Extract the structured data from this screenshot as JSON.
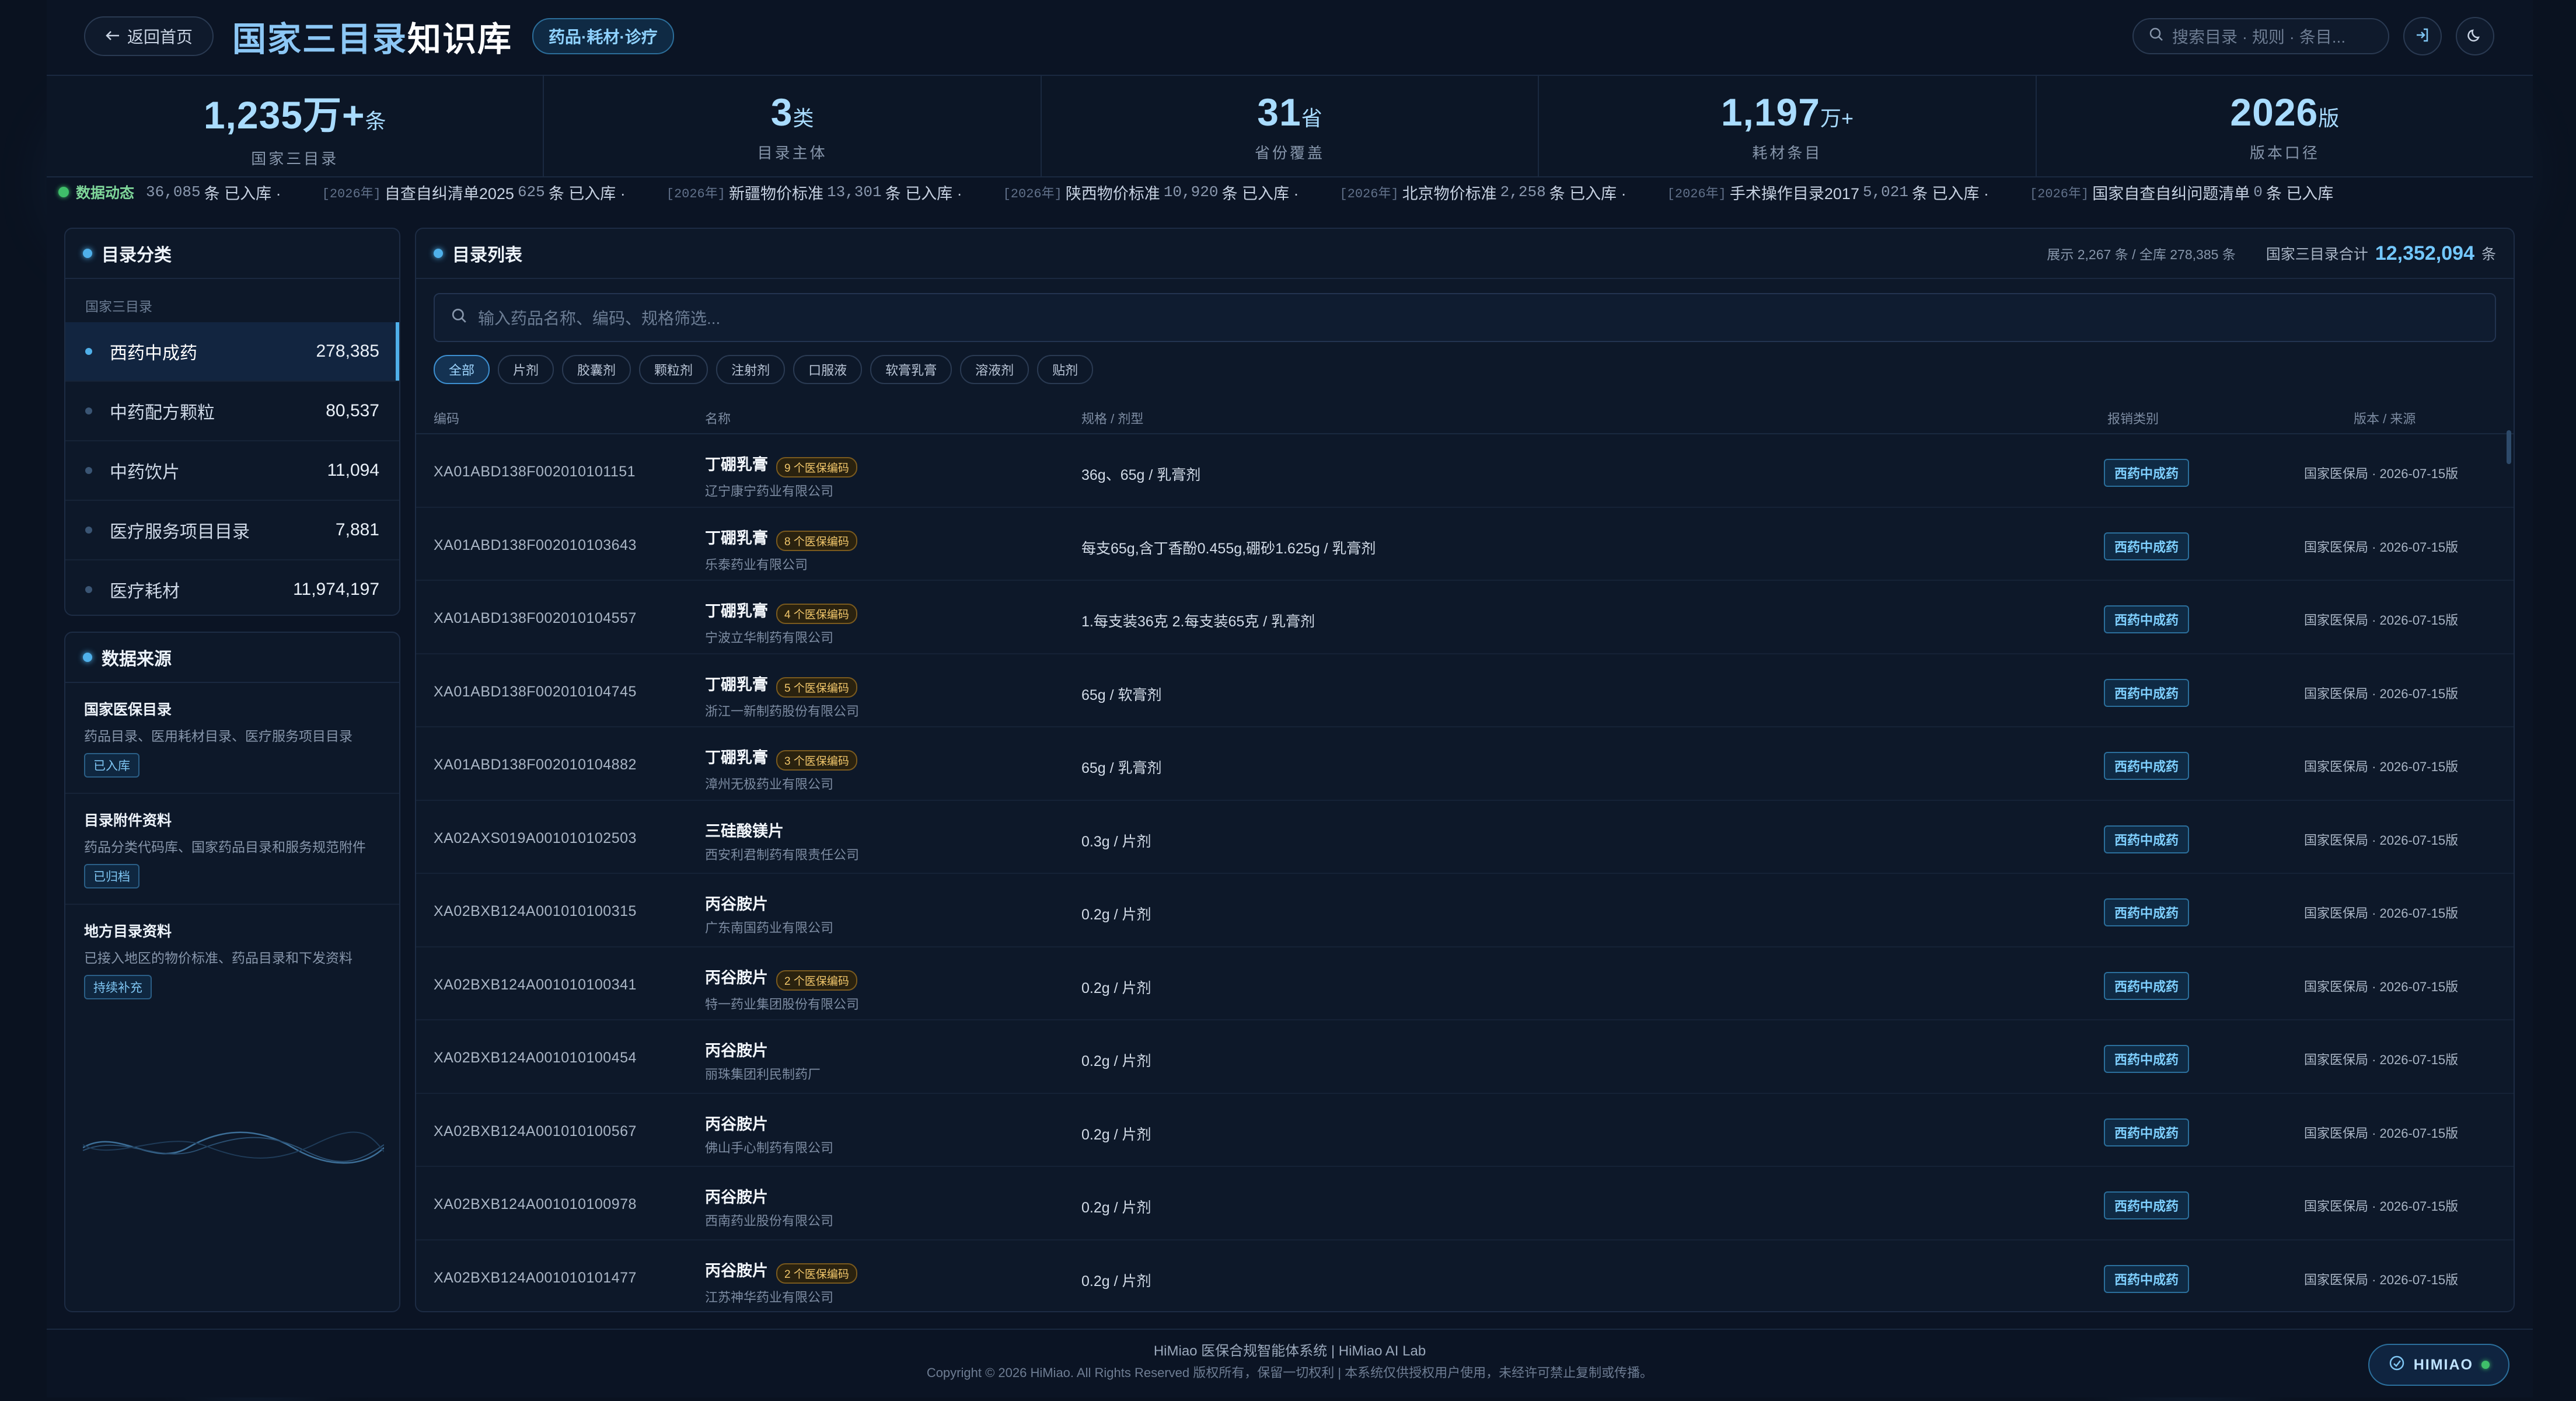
{
  "header": {
    "back_label": "返回首页",
    "title_accent": "国家三目录",
    "title_rest": "知识库",
    "tag": "药品·耗材·诊疗",
    "search_placeholder": "搜索目录 · 规则 · 条目..."
  },
  "stats": [
    {
      "value": "1,235万+",
      "unit": "条",
      "label": "国家三目录"
    },
    {
      "value": "3",
      "unit": "类",
      "label": "目录主体"
    },
    {
      "value": "31",
      "unit": "省",
      "label": "省份覆盖"
    },
    {
      "value": "1,197",
      "unit": "万+",
      "label": "耗材条目"
    },
    {
      "value": "2026",
      "unit": "版",
      "label": "版本口径"
    }
  ],
  "ticker": {
    "label": "数据动态",
    "lead_num": "36,085",
    "lead_suffix": "条 已入库 ·",
    "items": [
      {
        "year": "[2026年]",
        "name": "自查自纠清单2025",
        "num": "625",
        "suffix": "条 已入库 ·"
      },
      {
        "year": "[2026年]",
        "name": "新疆物价标准",
        "num": "13,301",
        "suffix": "条 已入库 ·"
      },
      {
        "year": "[2026年]",
        "name": "陕西物价标准",
        "num": "10,920",
        "suffix": "条 已入库 ·"
      },
      {
        "year": "[2026年]",
        "name": "北京物价标准",
        "num": "2,258",
        "suffix": "条 已入库 ·"
      },
      {
        "year": "[2026年]",
        "name": "手术操作目录2017",
        "num": "5,021",
        "suffix": "条 已入库 ·"
      },
      {
        "year": "[2026年]",
        "name": "国家自查自纠问题清单",
        "num": "0",
        "suffix": "条 已入库"
      }
    ]
  },
  "categories": {
    "title": "目录分类",
    "subtitle": "国家三目录",
    "items": [
      {
        "label": "西药中成药",
        "count": "278,385"
      },
      {
        "label": "中药配方颗粒",
        "count": "80,537"
      },
      {
        "label": "中药饮片",
        "count": "11,094"
      },
      {
        "label": "医疗服务项目目录",
        "count": "7,881"
      },
      {
        "label": "医疗耗材",
        "count": "11,974,197"
      }
    ]
  },
  "sources": {
    "title": "数据来源",
    "items": [
      {
        "title": "国家医保目录",
        "desc": "药品目录、医用耗材目录、医疗服务项目目录",
        "badge": "已入库"
      },
      {
        "title": "目录附件资料",
        "desc": "药品分类代码库、国家药品目录和服务规范附件",
        "badge": "已归档"
      },
      {
        "title": "地方目录资料",
        "desc": "已接入地区的物价标准、药品目录和下发资料",
        "badge": "持续补充"
      }
    ]
  },
  "list": {
    "title": "目录列表",
    "showing": "展示 2,267 条 / 全库 278,385 条",
    "total_label": "国家三目录合计",
    "total_value": "12,352,094",
    "total_unit": "条",
    "filter_placeholder": "输入药品名称、编码、规格筛选...",
    "chips": [
      "全部",
      "片剂",
      "胶囊剂",
      "颗粒剂",
      "注射剂",
      "口服液",
      "软膏乳膏",
      "溶液剂",
      "贴剂"
    ],
    "columns": {
      "code": "编码",
      "name": "名称",
      "spec": "规格 / 剂型",
      "type": "报销类别",
      "version": "版本 / 来源"
    },
    "rows": [
      {
        "code": "XA01ABD138F002010101151",
        "name": "丁硼乳膏",
        "badge": "9 个医保编码",
        "mfr": "辽宁康宁药业有限公司",
        "spec": "36g、65g / 乳膏剂",
        "type": "西药中成药",
        "version": "国家医保局 · 2026-07-15版"
      },
      {
        "code": "XA01ABD138F002010103643",
        "name": "丁硼乳膏",
        "badge": "8 个医保编码",
        "mfr": "乐泰药业有限公司",
        "spec": "每支65g,含丁香酚0.455g,硼砂1.625g / 乳膏剂",
        "type": "西药中成药",
        "version": "国家医保局 · 2026-07-15版"
      },
      {
        "code": "XA01ABD138F002010104557",
        "name": "丁硼乳膏",
        "badge": "4 个医保编码",
        "mfr": "宁波立华制药有限公司",
        "spec": "1.每支装36克 2.每支装65克 / 乳膏剂",
        "type": "西药中成药",
        "version": "国家医保局 · 2026-07-15版"
      },
      {
        "code": "XA01ABD138F002010104745",
        "name": "丁硼乳膏",
        "badge": "5 个医保编码",
        "mfr": "浙江一新制药股份有限公司",
        "spec": "65g / 软膏剂",
        "type": "西药中成药",
        "version": "国家医保局 · 2026-07-15版"
      },
      {
        "code": "XA01ABD138F002010104882",
        "name": "丁硼乳膏",
        "badge": "3 个医保编码",
        "mfr": "漳州无极药业有限公司",
        "spec": "65g / 乳膏剂",
        "type": "西药中成药",
        "version": "国家医保局 · 2026-07-15版"
      },
      {
        "code": "XA02AXS019A001010102503",
        "name": "三硅酸镁片",
        "badge": "",
        "mfr": "西安利君制药有限责任公司",
        "spec": "0.3g / 片剂",
        "type": "西药中成药",
        "version": "国家医保局 · 2026-07-15版"
      },
      {
        "code": "XA02BXB124A001010100315",
        "name": "丙谷胺片",
        "badge": "",
        "mfr": "广东南国药业有限公司",
        "spec": "0.2g / 片剂",
        "type": "西药中成药",
        "version": "国家医保局 · 2026-07-15版"
      },
      {
        "code": "XA02BXB124A001010100341",
        "name": "丙谷胺片",
        "badge": "2 个医保编码",
        "mfr": "特一药业集团股份有限公司",
        "spec": "0.2g / 片剂",
        "type": "西药中成药",
        "version": "国家医保局 · 2026-07-15版"
      },
      {
        "code": "XA02BXB124A001010100454",
        "name": "丙谷胺片",
        "badge": "",
        "mfr": "丽珠集团利民制药厂",
        "spec": "0.2g / 片剂",
        "type": "西药中成药",
        "version": "国家医保局 · 2026-07-15版"
      },
      {
        "code": "XA02BXB124A001010100567",
        "name": "丙谷胺片",
        "badge": "",
        "mfr": "佛山手心制药有限公司",
        "spec": "0.2g / 片剂",
        "type": "西药中成药",
        "version": "国家医保局 · 2026-07-15版"
      },
      {
        "code": "XA02BXB124A001010100978",
        "name": "丙谷胺片",
        "badge": "",
        "mfr": "西南药业股份有限公司",
        "spec": "0.2g / 片剂",
        "type": "西药中成药",
        "version": "国家医保局 · 2026-07-15版"
      },
      {
        "code": "XA02BXB124A001010101477",
        "name": "丙谷胺片",
        "badge": "2 个医保编码",
        "mfr": "江苏神华药业有限公司",
        "spec": "0.2g / 片剂",
        "type": "西药中成药",
        "version": "国家医保局 · 2026-07-15版"
      }
    ]
  },
  "footer": {
    "line1": "HiMiao 医保合规智能体系统  |  HiMiao AI Lab",
    "line2": "Copyright © 2026 HiMiao. All Rights Reserved  版权所有，保留一切权利  |  本系统仅供授权用户使用，未经许可禁止复制或传播。",
    "brand": "HIMIAO"
  },
  "colors": {
    "accent": "#4fb0ea",
    "background": "#0a1220",
    "badge_gold": "#f2c76b",
    "live_green": "#3fbf6a"
  }
}
